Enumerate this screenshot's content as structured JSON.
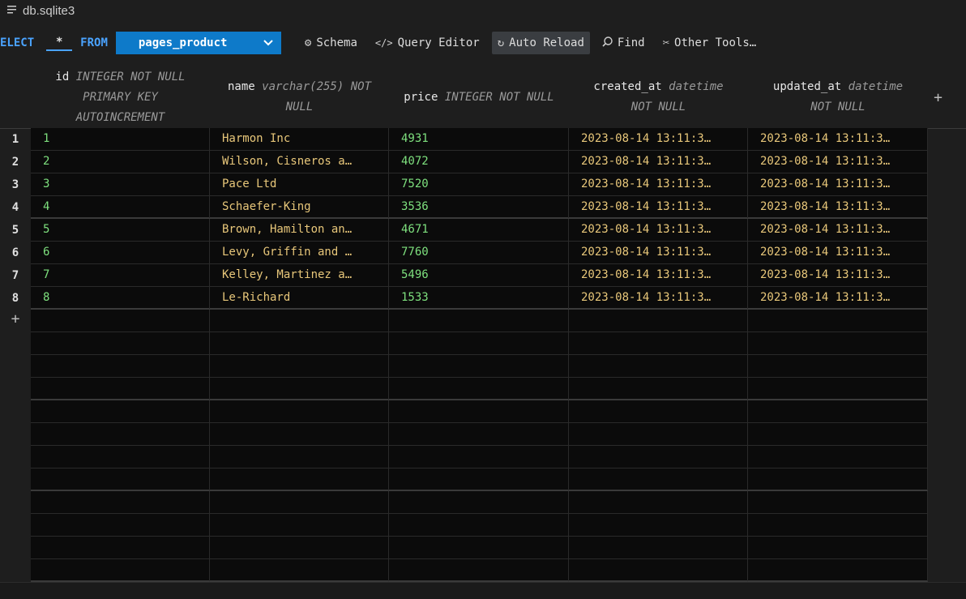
{
  "window": {
    "title": "db.sqlite3"
  },
  "toolbar": {
    "select_kw": "ELECT",
    "star": "*",
    "from_kw": "FROM",
    "table": "pages_product",
    "schema": "Schema",
    "query_editor": "Query Editor",
    "auto_reload": "Auto Reload",
    "find": "Find",
    "other_tools": "Other Tools…"
  },
  "columns": [
    {
      "name": "id",
      "type": "INTEGER NOT NULL PRIMARY KEY AUTOINCREMENT",
      "l1_name": "id",
      "l1_type": "INTEGER NOT NULL",
      "l2": "PRIMARY KEY",
      "l3": "AUTOINCREMENT"
    },
    {
      "name": "name",
      "l1_name": "name",
      "l1_type": "varchar(255) NOT",
      "l2": "NULL"
    },
    {
      "name": "price",
      "l1_name": "price",
      "l1_type": "INTEGER NOT NULL"
    },
    {
      "name": "created_at",
      "l1_name": "created_at",
      "l1_type": "datetime",
      "l2": "NOT NULL"
    },
    {
      "name": "updated_at",
      "l1_name": "updated_at",
      "l1_type": "datetime",
      "l2": "NOT NULL"
    }
  ],
  "rows": [
    {
      "n": "1",
      "id": "1",
      "name": "Harmon Inc",
      "price": "4931",
      "created_at": "2023-08-14 13:11:3…",
      "updated_at": "2023-08-14 13:11:3…"
    },
    {
      "n": "2",
      "id": "2",
      "name": "Wilson, Cisneros a…",
      "price": "4072",
      "created_at": "2023-08-14 13:11:3…",
      "updated_at": "2023-08-14 13:11:3…"
    },
    {
      "n": "3",
      "id": "3",
      "name": "Pace Ltd",
      "price": "7520",
      "created_at": "2023-08-14 13:11:3…",
      "updated_at": "2023-08-14 13:11:3…"
    },
    {
      "n": "4",
      "id": "4",
      "name": "Schaefer-King",
      "price": "3536",
      "created_at": "2023-08-14 13:11:3…",
      "updated_at": "2023-08-14 13:11:3…"
    },
    {
      "n": "5",
      "id": "5",
      "name": "Brown, Hamilton an…",
      "price": "4671",
      "created_at": "2023-08-14 13:11:3…",
      "updated_at": "2023-08-14 13:11:3…"
    },
    {
      "n": "6",
      "id": "6",
      "name": "Levy, Griffin and …",
      "price": "7760",
      "created_at": "2023-08-14 13:11:3…",
      "updated_at": "2023-08-14 13:11:3…"
    },
    {
      "n": "7",
      "id": "7",
      "name": "Kelley, Martinez a…",
      "price": "5496",
      "created_at": "2023-08-14 13:11:3…",
      "updated_at": "2023-08-14 13:11:3…"
    },
    {
      "n": "8",
      "id": "8",
      "name": "Le-Richard",
      "price": "1533",
      "created_at": "2023-08-14 13:11:3…",
      "updated_at": "2023-08-14 13:11:3…"
    }
  ],
  "add_symbol": "+"
}
